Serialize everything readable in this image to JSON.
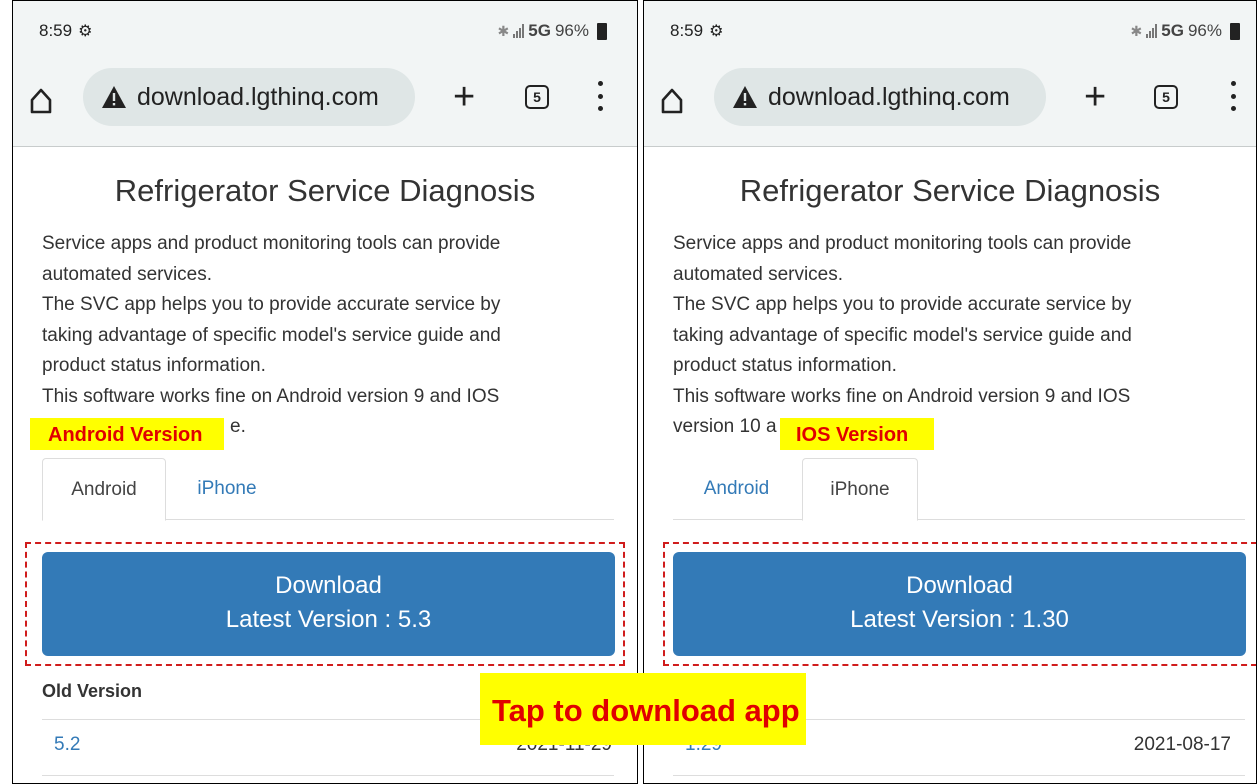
{
  "status_bar": {
    "time": "8:59",
    "network": "5G",
    "battery": "96%"
  },
  "browser": {
    "url": "download.lgthinq.com",
    "tab_count": "5"
  },
  "page": {
    "title": "Refrigerator Service Diagnosis",
    "desc_line1": "Service apps and product monitoring tools can provide",
    "desc_line2": "automated services.",
    "desc_line3": "The SVC app helps you to provide accurate service by",
    "desc_line4": "taking advantage of specific model's service guide and",
    "desc_line5": "product status information.",
    "desc_line6": "This software works fine on Android version 9 and IOS",
    "desc_line7_left": "e.",
    "desc_line7_right": "version 10 a",
    "tab_android": "Android",
    "tab_iphone": "iPhone",
    "download_label": "Download",
    "old_version_label": "Old Version"
  },
  "android": {
    "latest": "Latest Version : 5.3",
    "old_version": "5.2",
    "old_date": "2021-11-29"
  },
  "ios": {
    "latest": "Latest Version : 1.30",
    "old_version": "1.29",
    "old_date": "2021-08-17"
  },
  "callouts": {
    "android": "Android Version",
    "ios": "IOS Version",
    "tap": "Tap to download app"
  },
  "colors": {
    "link_blue": "#337ab7",
    "button_blue": "#337ab7",
    "callout_bg": "#ffff00",
    "callout_text": "#e00000",
    "dashed_frame": "#d01c1c"
  },
  "icons": {
    "settings": "gear-icon",
    "bluetooth": "bluetooth-icon",
    "home": "home-icon",
    "warning": "warning-icon",
    "new_tab": "plus-icon",
    "tabs": "tabs-icon",
    "menu": "menu-icon"
  }
}
